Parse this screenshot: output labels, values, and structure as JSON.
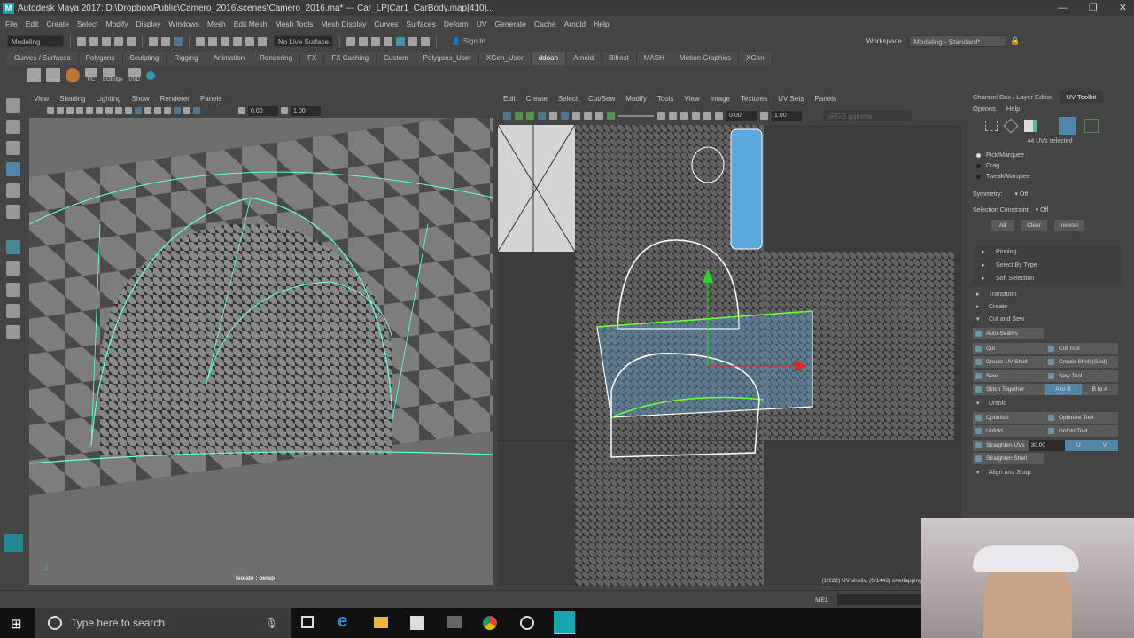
{
  "title": "Autodesk Maya 2017: D:\\Dropbox\\Public\\Camero_2016\\scenes\\Camero_2016.ma*  ---  Car_LP|Car1_CarBody.map[410]...",
  "window_buttons": [
    "—",
    "❐",
    "✕"
  ],
  "menus": [
    "File",
    "Edit",
    "Create",
    "Select",
    "Modify",
    "Display",
    "Windows",
    "Mesh",
    "Edit Mesh",
    "Mesh Tools",
    "Mesh Display",
    "Curves",
    "Surfaces",
    "Deform",
    "UV",
    "Generate",
    "Cache",
    "Arnold",
    "Help"
  ],
  "status": {
    "mode": "Modeling",
    "live_surface": "No Live Surface",
    "sign_in": "Sign In",
    "workspace_label": "Workspace :",
    "workspace": "Modeling - Standard*"
  },
  "shelf_tabs": [
    "Curves / Surfaces",
    "Polygons",
    "Sculpting",
    "Rigging",
    "Animation",
    "Rendering",
    "FX",
    "FX Caching",
    "Custom",
    "Polygons_User",
    "XGen_User",
    "ddoan",
    "Arnold",
    "Bifrost",
    "MASH",
    "Motion Graphics",
    "XGen"
  ],
  "shelf_active": "ddoan",
  "shelf_icon_labels": [
    "PC",
    "EOEdge",
    "UVD"
  ],
  "viewport": {
    "menus": [
      "View",
      "Shading",
      "Lighting",
      "Show",
      "Renderer",
      "Panels"
    ],
    "val1": "0.00",
    "val2": "1.00",
    "label": "Isolate : persp"
  },
  "uv_editor": {
    "menus": [
      "Edit",
      "Create",
      "Select",
      "Cut/Sew",
      "Modify",
      "Tools",
      "View",
      "Image",
      "Textures",
      "UV Sets",
      "Panels"
    ],
    "val1": "0.00",
    "val2": "1.00",
    "colorspace": "sRGB gamma",
    "status": "(1/222) UV shells, (0/1442) overlapping UVs, (0/683) r"
  },
  "right_panel": {
    "tabs": [
      "Channel Box / Layer Editor",
      "UV Toolkit"
    ],
    "menus": [
      "Options",
      "Help"
    ],
    "selected": "44 UVs selected",
    "modes": [
      "Pick/Marquee",
      "Drag",
      "Tweak/Marquee"
    ],
    "symmetry_label": "Symmetry:",
    "symmetry": "Off",
    "constraint_label": "Selection Constraint:",
    "constraint": "Off",
    "sel_buttons": [
      "All",
      "Clear",
      "Inverse"
    ],
    "subsections": [
      "Pinning",
      "Select By Type",
      "Soft Selection"
    ],
    "sections": {
      "transform": "Transform",
      "create": "Create",
      "cut_sew": "Cut and Sew",
      "unfold": "Unfold",
      "align": "Align and Snap"
    },
    "cut_sew": {
      "auto_seams": "Auto-Seams",
      "cut": "Cut",
      "cut_tool": "Cut Tool",
      "create_shell": "Create UV Shell",
      "create_shell_grid": "Create Shell (Grid)",
      "sew": "Sew",
      "sew_tool": "Sew Tool",
      "stitch": "Stitch Together",
      "a_to_b": "A to B",
      "b_to_a": "B to A"
    },
    "unfold": {
      "optimize": "Optimize",
      "optimize_tool": "Optimize Tool",
      "unfold": "Unfold",
      "unfold_tool": "Unfold Tool",
      "straighten": "Straighten UVs",
      "straighten_val": "30.00",
      "u": "U",
      "v": "V",
      "straighten_shell": "Straighten Shell"
    }
  },
  "cmd": {
    "mel": "MEL"
  },
  "taskbar": {
    "search": "Type here to search"
  }
}
